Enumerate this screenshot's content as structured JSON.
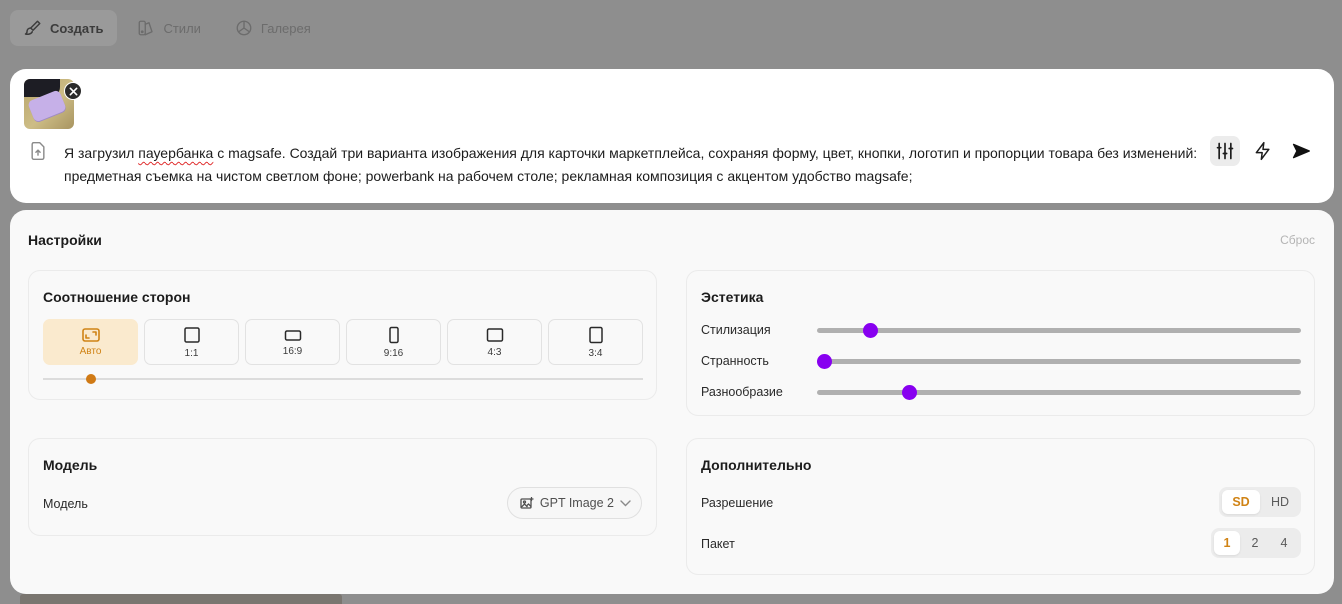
{
  "nav": {
    "items": [
      {
        "label": "Создать",
        "icon": "brush-icon",
        "active": true
      },
      {
        "label": "Стили",
        "icon": "styles-icon",
        "active": false
      },
      {
        "label": "Галерея",
        "icon": "gallery-icon",
        "active": false
      }
    ]
  },
  "prompt": {
    "text_start": "Я загрузил ",
    "text_misspelled": "пауербанка",
    "text_end": " с magsafe. Создай три варианта изображения для карточки маркетплейса, сохраняя форму, цвет, кнопки, логотип и пропорции товара без изменений: предметная съемка на чистом светлом фоне; powerbank на рабочем столе; рекламная композиция с акцентом удобство magsafe;"
  },
  "settings": {
    "title": "Настройки",
    "reset_label": "Сброс",
    "aspect": {
      "title": "Соотношение сторон",
      "options": [
        {
          "label": "Авто",
          "icon": "auto-ratio-icon",
          "active": true
        },
        {
          "label": "1:1",
          "icon": "square-icon",
          "active": false
        },
        {
          "label": "16:9",
          "icon": "landscape-wide-icon",
          "active": false
        },
        {
          "label": "9:16",
          "icon": "portrait-tall-icon",
          "active": false
        },
        {
          "label": "4:3",
          "icon": "landscape-icon",
          "active": false
        },
        {
          "label": "3:4",
          "icon": "portrait-icon",
          "active": false
        }
      ],
      "slider_position": 0.08
    },
    "aesthetics": {
      "title": "Эстетика",
      "sliders": [
        {
          "label": "Стилизация",
          "value": 0.11
        },
        {
          "label": "Странность",
          "value": 0.015
        },
        {
          "label": "Разнообразие",
          "value": 0.19
        }
      ]
    },
    "model": {
      "title": "Модель",
      "label": "Модель",
      "selected": "GPT Image 2"
    },
    "extra": {
      "title": "Дополнительно",
      "resolution_label": "Разрешение",
      "resolution_options": [
        {
          "label": "SD",
          "active": true
        },
        {
          "label": "HD",
          "active": false
        }
      ],
      "batch_label": "Пакет",
      "batch_options": [
        {
          "label": "1",
          "active": true
        },
        {
          "label": "2",
          "active": false
        },
        {
          "label": "4",
          "active": false
        }
      ]
    },
    "colors": {
      "accent": "#d08315",
      "slider": "#8800f0"
    }
  }
}
